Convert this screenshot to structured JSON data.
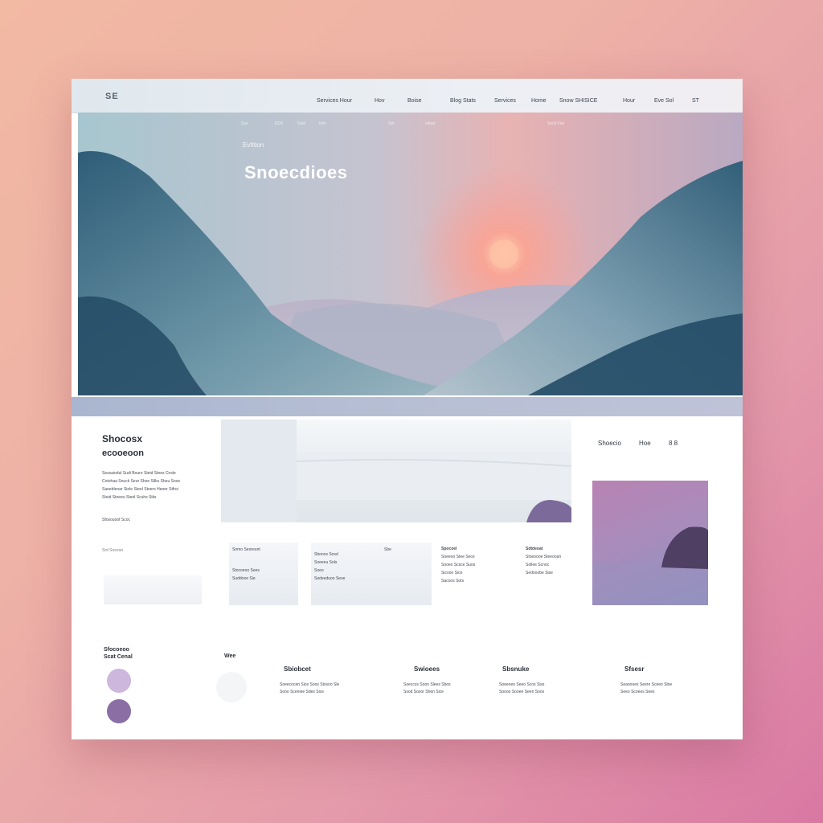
{
  "header": {
    "logo": "SE",
    "nav": [
      "Services Hour",
      "Hov",
      "Boise",
      "Blog Stats",
      "Services",
      "Home",
      "Snow SHISICE",
      "Hour",
      "Eve Sol",
      "ST"
    ]
  },
  "hero": {
    "subtitle": "Evfition",
    "title": "Snoecdioes",
    "nav": [
      "Sus",
      "EDS",
      "Sold",
      "Info",
      "Sirr",
      "Iaibal",
      "Soch Fiel"
    ]
  },
  "intro": {
    "title1": "Shocosx",
    "title2": "ecooeoon",
    "lines": [
      "Sessaiodul Sudi Bouro Steid Stees Cnsle",
      "Cotohaa Snuck Seur Shoe Silks Shou Soos",
      "Saeeblenar Siele Steel Steers Heoer Stfroi",
      "Stoid Stoeeu Steel Scuhs Stiis"
    ],
    "link": "Sfosouoof Scoc",
    "caption": "Srd Sosoun"
  },
  "right_panel": {
    "label": "Shoecio",
    "meta": "Hoe",
    "count": "8 8"
  },
  "cards": [
    {
      "title": "Snmo Seoreunt",
      "lines": [
        "Stocoeoo Sees",
        "Suddone Sie"
      ]
    },
    {
      "title": "Sbonos Sosd",
      "lines": [
        "Soeeeu Sols",
        "Soeo",
        "Sedeeduoo Sese"
      ]
    },
    {
      "title": "Sbe",
      "lines": []
    },
    {
      "title": "Spocoel",
      "lines": [
        "Soeeoo Stee Sece",
        "Sooeo Scsce Suos",
        "Sicooo Sice",
        "Sacoos Sots"
      ]
    },
    {
      "title": "Sdtdeoat",
      "lines": [
        "Stoeoooe Steeooun",
        "Sollee Scnoc",
        "Sedooobe Sise"
      ]
    }
  ],
  "footer": {
    "side_title1": "Sfocoeoo",
    "side_title2": "Scat Cenal",
    "items": [
      {
        "title": "Wee",
        "lines": []
      },
      {
        "title": "Sbiobcet",
        "lines": [
          "Soeecocen Sice Soos Stssoo Sle",
          "Sooo Sceniee Sdes Sice"
        ]
      },
      {
        "title": "Swioees",
        "lines": [
          "Soeccss Soon Slees Sbos",
          "Ssod Sosor Shen Sice"
        ]
      },
      {
        "title": "Sbsnuke",
        "lines": [
          "Soeeoeo Seeo Scos Siss",
          "Soooo Sooee Seen Soos"
        ]
      },
      {
        "title": "Sfsesr",
        "lines": [
          "Seaoooes Seere Sceeo Sloe",
          "Seeo Scoees Sees"
        ]
      }
    ]
  },
  "colors": {
    "accent_lilac": "#cdb7dd",
    "accent_purple": "#8a6ea4"
  }
}
